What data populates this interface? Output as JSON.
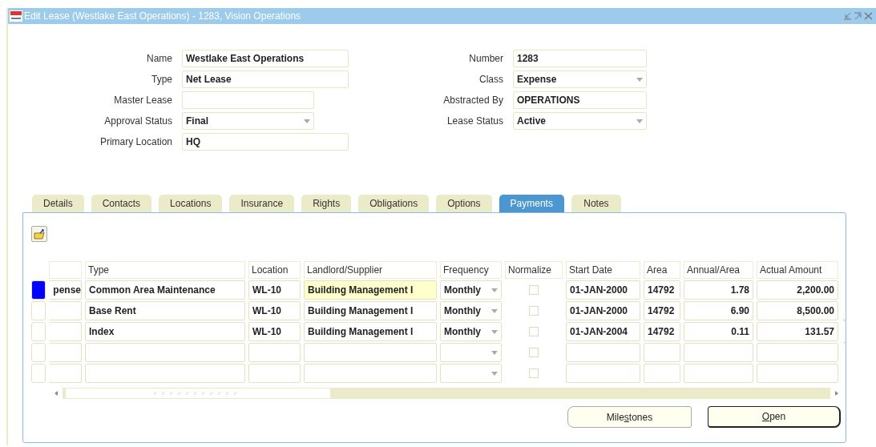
{
  "window": {
    "title": "Edit Lease (Westlake East Operations) - 1283, Vision Operations"
  },
  "left_fields": [
    {
      "label": "Name",
      "value": "Westlake East Operations",
      "kind": "text",
      "wide": true
    },
    {
      "label": "Type",
      "value": "Net Lease",
      "kind": "text",
      "wide": true
    },
    {
      "label": "Master Lease",
      "kind": "text",
      "wide": false
    },
    {
      "label": "Approval Status",
      "value": "Final",
      "kind": "select",
      "wide": false
    },
    {
      "label": "Primary Location",
      "value": "HQ",
      "kind": "text",
      "wide": true
    }
  ],
  "right_fields": [
    {
      "label": "Number",
      "value": "1283",
      "kind": "text"
    },
    {
      "label": "Class",
      "value": "Expense",
      "kind": "select"
    },
    {
      "label": "Abstracted By",
      "value": "OPERATIONS",
      "kind": "text"
    },
    {
      "label": "Lease Status",
      "value": "Active",
      "kind": "select"
    }
  ],
  "tabs": [
    {
      "label": "Details",
      "selected": false
    },
    {
      "label": "Contacts",
      "selected": false
    },
    {
      "label": "Locations",
      "selected": false
    },
    {
      "label": "Insurance",
      "selected": false
    },
    {
      "label": "Rights",
      "selected": false
    },
    {
      "label": "Obligations",
      "selected": false
    },
    {
      "label": "Options",
      "selected": false
    },
    {
      "label": "Payments",
      "selected": true
    },
    {
      "label": "Notes",
      "selected": false
    }
  ],
  "table": {
    "columns": [
      "Type",
      "Location",
      "Landlord/Supplier",
      "Frequency",
      "Normalize",
      "Start Date",
      "Area",
      "Annual/Area",
      "Actual Amount"
    ],
    "rows": [
      {
        "selected": true,
        "column_1": "pense",
        "type": "Common Area Maintenance",
        "location": "WL-10",
        "landlord": "Building Management I",
        "landlord_focused": true,
        "frequency": "Monthly",
        "normalize": false,
        "start_date": "01-JAN-2000",
        "area": "14792",
        "annual_area": "1.78",
        "actual_amount": "2,200.00"
      },
      {
        "selected": false,
        "type": "Base Rent",
        "location": "WL-10",
        "landlord": "Building Management I",
        "landlord_focused": false,
        "frequency": "Monthly",
        "normalize": false,
        "start_date": "01-JAN-2000",
        "area": "14792",
        "annual_area": "6.90",
        "actual_amount": "8,500.00"
      },
      {
        "selected": false,
        "type": "Index",
        "location": "WL-10",
        "landlord": "Building Management I",
        "landlord_focused": false,
        "frequency": "Monthly",
        "normalize": false,
        "start_date": "01-JAN-2004",
        "area": "14792",
        "annual_area": "0.11",
        "actual_amount": "131.57"
      },
      {
        "selected": false,
        "landlord_focused": false,
        "normalize": false
      },
      {
        "selected": false,
        "landlord_focused": false,
        "normalize": false
      }
    ]
  },
  "buttons": [
    {
      "before": "Mile",
      "key": "s",
      "after": "tones",
      "default": false
    },
    {
      "key": "O",
      "after": "pen",
      "default": true
    }
  ]
}
